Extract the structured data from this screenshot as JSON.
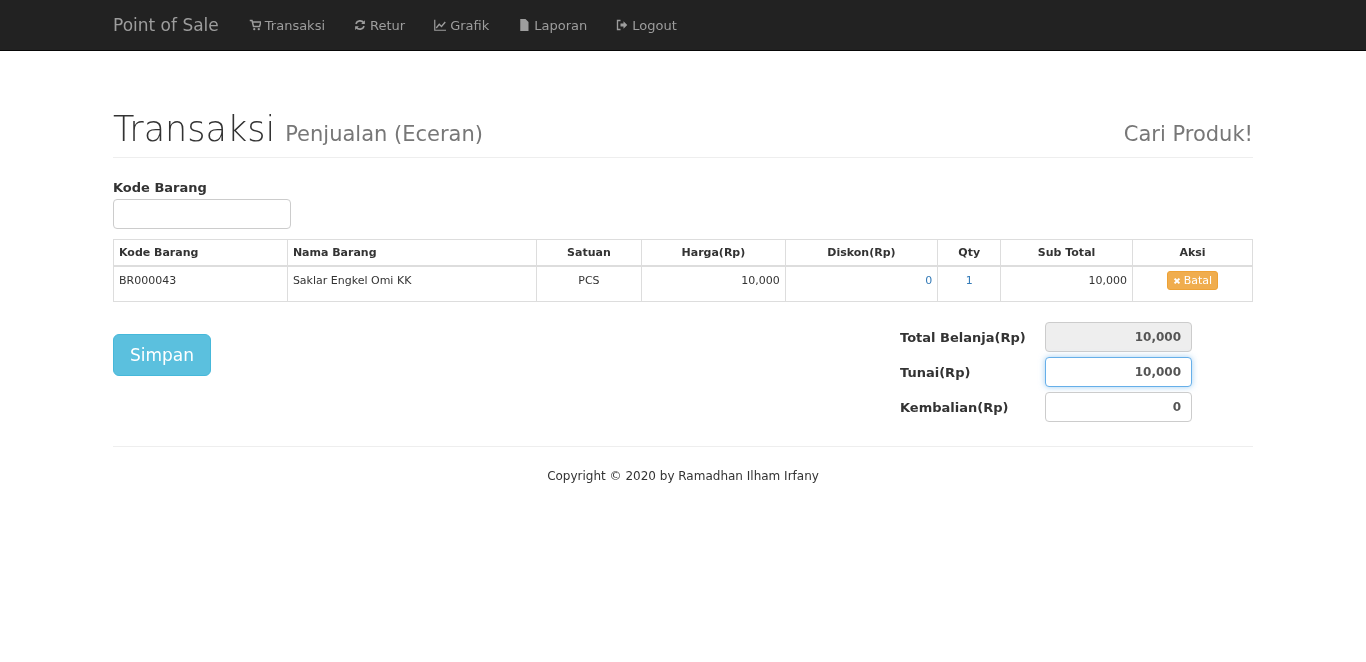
{
  "navbar": {
    "brand": "Point of Sale",
    "items": [
      {
        "label": "Transaksi",
        "selected": false
      },
      {
        "label": "Retur",
        "selected": false
      },
      {
        "label": "Grafik",
        "selected": false
      },
      {
        "label": "Laporan",
        "selected": false
      },
      {
        "label": "Logout",
        "selected": false
      }
    ]
  },
  "header": {
    "title": "Transaksi",
    "subtitle": "Penjualan (Eceran)",
    "search_link": "Cari Produk!"
  },
  "code_field": {
    "label": "Kode Barang"
  },
  "table": {
    "columns": [
      "Kode Barang",
      "Nama Barang",
      "Satuan",
      "Harga(Rp)",
      "Diskon(Rp)",
      "Qty",
      "Sub Total",
      "Aksi"
    ],
    "rows": [
      {
        "cells": [
          {
            "kind": "text",
            "text": "BR000043"
          },
          {
            "kind": "text",
            "text": "Saklar Engkel Omi KK"
          },
          {
            "kind": "text",
            "text": "PCS"
          },
          {
            "kind": "text",
            "text": "10,000"
          },
          {
            "kind": "link",
            "text": "0"
          },
          {
            "kind": "link",
            "text": "1"
          },
          {
            "kind": "text",
            "text": "10,000"
          },
          {
            "kind": "button",
            "text": "Batal"
          }
        ]
      }
    ]
  },
  "save_button": "Simpan",
  "summary": [
    {
      "label": "Total Belanja(Rp)",
      "value": "10,000",
      "disabled": true,
      "focused": false
    },
    {
      "label": "Tunai(Rp)",
      "value": "10,000",
      "disabled": false,
      "focused": true
    },
    {
      "label": "Kembalian(Rp)",
      "value": "0",
      "disabled": false,
      "focused": false
    }
  ],
  "footer": "Copyright © 2020 by Ramadhan Ilham Irfany"
}
